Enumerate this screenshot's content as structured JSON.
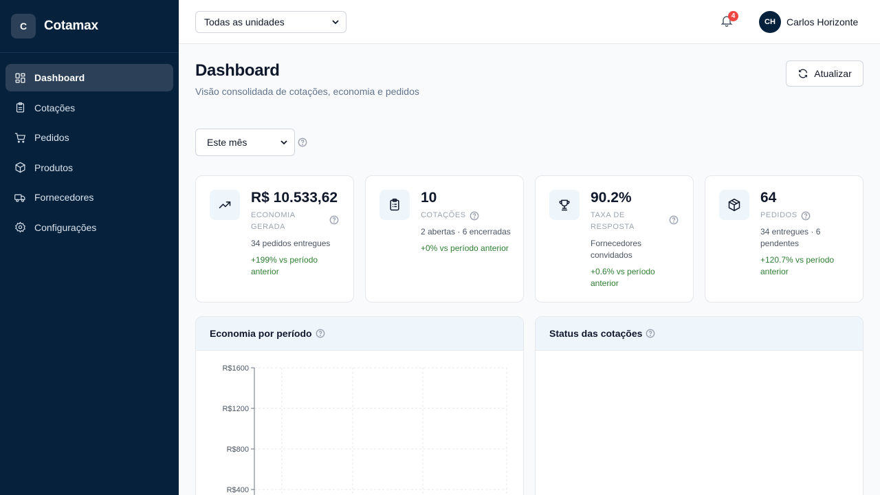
{
  "brand": {
    "logo_letter": "C",
    "name": "Cotamax"
  },
  "nav": {
    "items": [
      {
        "label": "Dashboard",
        "icon": "dashboard-icon",
        "active": true
      },
      {
        "label": "Cotações",
        "icon": "clipboard-icon",
        "active": false
      },
      {
        "label": "Pedidos",
        "icon": "cart-icon",
        "active": false
      },
      {
        "label": "Produtos",
        "icon": "box-icon",
        "active": false
      },
      {
        "label": "Fornecedores",
        "icon": "truck-icon",
        "active": false
      },
      {
        "label": "Configurações",
        "icon": "gear-icon",
        "active": false
      }
    ]
  },
  "topbar": {
    "unit_select": "Todas as unidades",
    "notifications_count": "4",
    "user": {
      "initials": "CH",
      "name": "Carlos Horizonte"
    }
  },
  "header": {
    "title": "Dashboard",
    "subtitle": "Visão consolidada de cotações, economia e pedidos",
    "refresh_label": "Atualizar"
  },
  "filters": {
    "period": "Este mês"
  },
  "kpis": [
    {
      "icon": "trending-up-icon",
      "value": "R$ 10.533,62",
      "label": "ECONOMIA GERADA",
      "sub": "34 pedidos entregues",
      "delta": "+199% vs período anterior"
    },
    {
      "icon": "clipboard-list-icon",
      "value": "10",
      "label": "COTAÇÕES",
      "sub": "2 abertas · 6 encerradas",
      "delta": "+0% vs período anterior"
    },
    {
      "icon": "trophy-icon",
      "value": "90.2%",
      "label": "TAXA DE RESPOSTA",
      "sub": "Fornecedores convidados",
      "delta": "+0.6% vs período anterior"
    },
    {
      "icon": "box-icon",
      "value": "64",
      "label": "PEDIDOS",
      "sub": "34 entregues · 6 pendentes",
      "delta": "+120.7% vs período anterior"
    }
  ],
  "panels": {
    "savings_title": "Economia por período",
    "status_title": "Status das cotações"
  },
  "chart_data": {
    "type": "bar",
    "title": "Economia por período",
    "yticks": [
      "R$1600",
      "R$1200",
      "R$800",
      "R$400"
    ],
    "ylim": [
      0,
      1600
    ],
    "grid": true
  },
  "colors": {
    "sidebar": "#05213c",
    "accent_bg": "#eef6fc",
    "positive": "#2e7d32",
    "badge": "#ef4444"
  }
}
